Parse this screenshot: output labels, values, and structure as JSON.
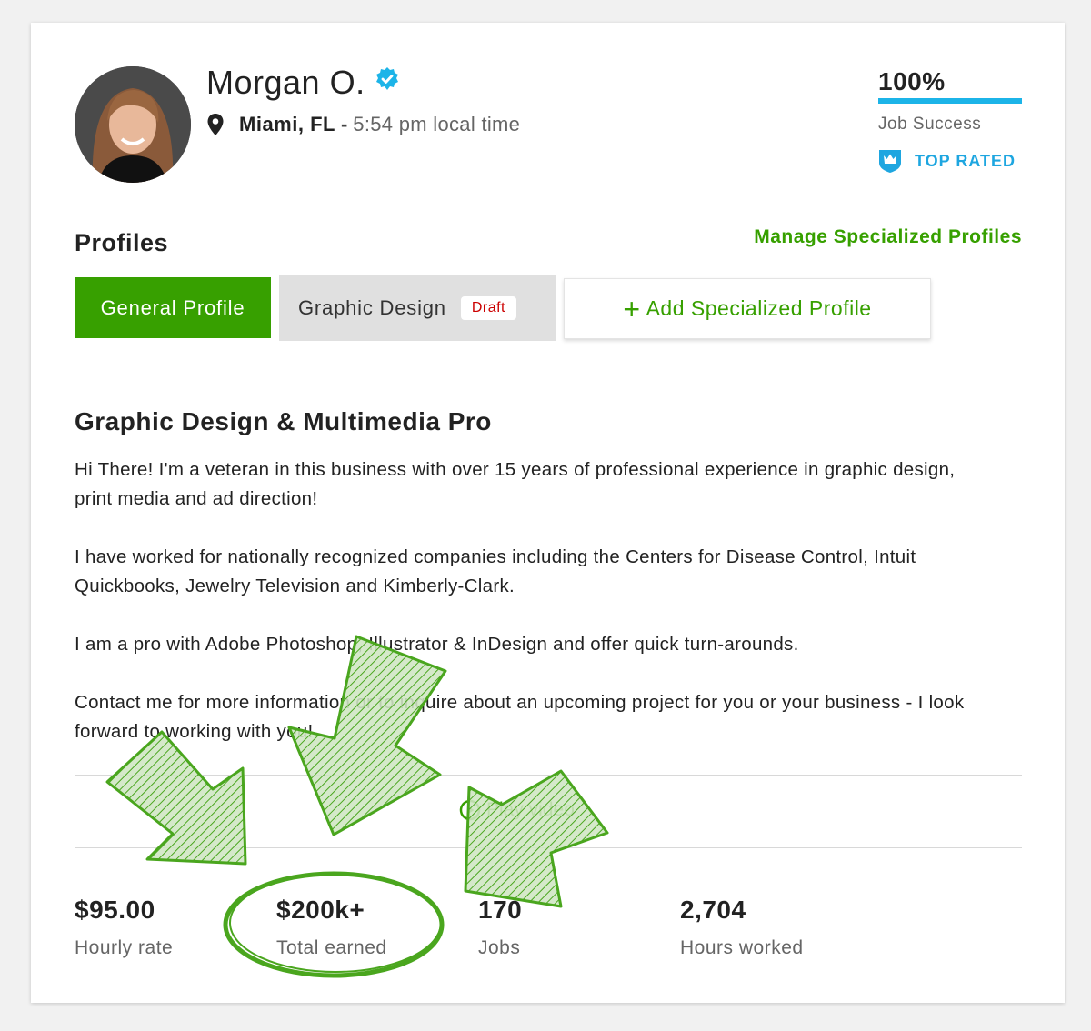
{
  "profile": {
    "name": "Morgan O.",
    "city": "Miami, FL",
    "separator": "-",
    "local_time": "5:54 pm local time"
  },
  "job_success": {
    "percent_label": "100%",
    "percent_value": 100,
    "label": "Job Success",
    "badge": "TOP RATED"
  },
  "profiles_section": {
    "title": "Profiles",
    "manage_link": "Manage Specialized Profiles",
    "tabs": {
      "general": "General Profile",
      "graphic": "Graphic Design",
      "graphic_badge": "Draft",
      "add_plus": "+",
      "add": "Add Specialized Profile"
    }
  },
  "overview": {
    "headline": "Graphic Design & Multimedia Pro",
    "paragraphs": [
      "Hi There! I'm a veteran in this business with over 15 years of professional experience in graphic design, print media and ad direction!",
      "I have worked for nationally recognized companies including the Centers for Disease Control, Intuit Quickbooks, Jewelry Television and Kimberly-Clark.",
      "I am a pro with Adobe Photoshop, Illustrator & InDesign and offer quick turn-arounds.",
      "Contact me for more information or to inquire about an upcoming project for you or your business - I look forward to working with you!"
    ]
  },
  "video_link": "Play video",
  "stats": [
    {
      "value": "$95.00",
      "label": "Hourly rate"
    },
    {
      "value": "$200k+",
      "label": "Total earned"
    },
    {
      "value": "170",
      "label": "Jobs"
    },
    {
      "value": "2,704",
      "label": "Hours worked"
    }
  ],
  "colors": {
    "brand_green": "#37a000",
    "accent_blue": "#1cb4e8",
    "draft_red": "#cc0000",
    "annotation_green": "#4aa61e"
  },
  "icons": {
    "verified": "verified-badge-icon",
    "location": "map-pin-icon",
    "top_rated": "crown-shield-icon",
    "play": "play-circle-icon"
  }
}
